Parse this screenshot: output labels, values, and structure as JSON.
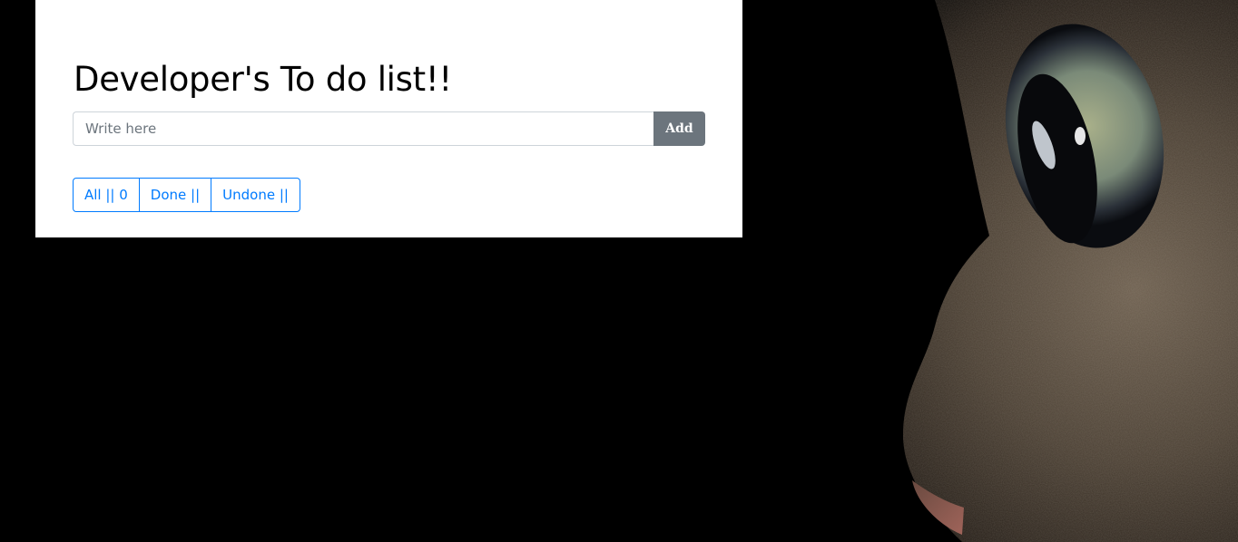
{
  "todo": {
    "title": "Developer's To do list!!",
    "input_placeholder": "Write here",
    "input_value": "",
    "add_label": "Add"
  },
  "filters": [
    {
      "label": "All || 0"
    },
    {
      "label": "Done ||"
    },
    {
      "label": "Undone ||"
    }
  ],
  "colors": {
    "page_background": "#000000",
    "card_background": "#ffffff",
    "add_button": "#6c757d",
    "filter_accent": "#007bff"
  }
}
